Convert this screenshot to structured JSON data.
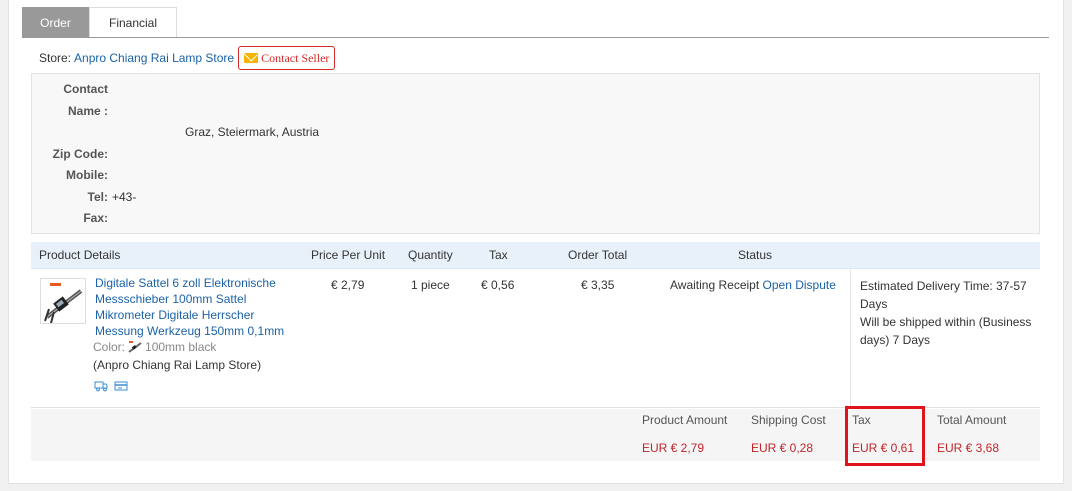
{
  "tabs": [
    {
      "label": "Order",
      "active": true
    },
    {
      "label": "Financial",
      "active": false
    }
  ],
  "store": {
    "label": "Store:",
    "name": "Anpro Chiang Rai Lamp Store",
    "contact_label": "Contact Seller"
  },
  "address": {
    "contact_name_label_1": "Contact",
    "contact_name_label_2": "Name :",
    "contact_name_value": "",
    "address_value": "Graz, Steiermark, Austria",
    "zip_label": "Zip Code:",
    "mobile_label": "Mobile:",
    "tel_label": "Tel:",
    "tel_value": "+43-",
    "fax_label": "Fax:"
  },
  "table": {
    "headers": {
      "product_details": "Product Details",
      "price_per_unit": "Price Per Unit",
      "quantity": "Quantity",
      "tax": "Tax",
      "order_total": "Order Total",
      "status": "Status"
    },
    "row": {
      "title": "Digitale Sattel 6 zoll Elektronische Messschieber 100mm Sattel Mikrometer Digitale Herrscher Messung Werkzeug 150mm 0,1mm",
      "color_label": "Color:",
      "color_value": "100mm black",
      "store": "(Anpro Chiang Rai Lamp Store)",
      "price": "€ 2,79",
      "quantity": "1 piece",
      "tax": "€ 0,56",
      "order_total": "€ 3,35",
      "status": "Awaiting Receipt",
      "dispute_link": "Open Dispute",
      "delivery_line1": "Estimated Delivery Time: 37-57 Days",
      "delivery_line2": "Will be shipped within (Business days) 7 Days"
    }
  },
  "totals": {
    "product_amount_label": "Product Amount",
    "product_amount_value": "EUR € 2,79",
    "shipping_cost_label": "Shipping Cost",
    "shipping_cost_value": "EUR € 0,28",
    "tax_label": "Tax",
    "tax_value": "EUR € 0,61",
    "total_amount_label": "Total Amount",
    "total_amount_value": "EUR € 3,68"
  },
  "colors": {
    "link": "#1b62a8",
    "price_red": "#c0252a",
    "highlight": "#e0141b",
    "header_bg": "#e8f1fa"
  }
}
